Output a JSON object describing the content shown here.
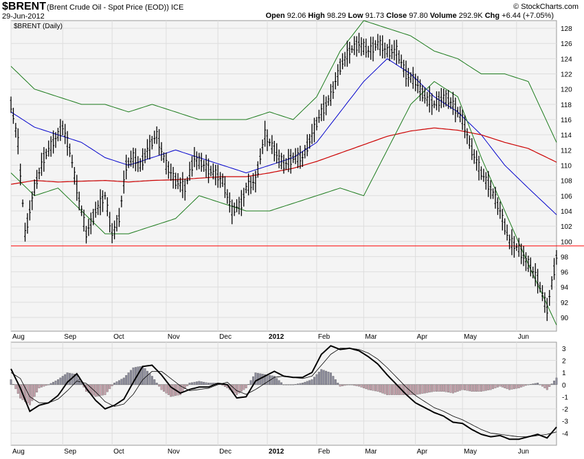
{
  "header": {
    "symbol": "$BRENT",
    "description": "(Brent Crude Oil - Spot Price (EOD))",
    "exchange": "ICE",
    "date": "29-Jun-2012",
    "brand": "© StockCharts.com",
    "open_label": "Open",
    "open": "92.06",
    "high_label": "High",
    "high": "98.29",
    "low_label": "Low",
    "low": "91.73",
    "close_label": "Close",
    "close": "97.80",
    "volume_label": "Volume",
    "volume": "292.9K",
    "chg_label": "Chg",
    "chg": "+6.44 (+7.05%)"
  },
  "colors": {
    "ma_fast": "#0000cc",
    "ma_slow": "#cc0000",
    "bollinger": "#1a7a1a",
    "support_line": "#ff0000",
    "histogram_pos": "#8a8a9a",
    "histogram_neg": "#c4a0aa"
  },
  "chart_data": [
    {
      "type": "line",
      "panel": "price",
      "legend_text": "$BRENT (Daily)",
      "x_ticks": [
        "Aug",
        "Sep",
        "Oct",
        "Nov",
        "Dec",
        "2012",
        "Feb",
        "Mar",
        "Apr",
        "May",
        "Jun"
      ],
      "x_tick_values": [
        0,
        22,
        43,
        66,
        88,
        109,
        130,
        150,
        172,
        192,
        215
      ],
      "y_ticks": [
        90,
        92,
        94,
        96,
        98,
        100,
        102,
        104,
        106,
        108,
        110,
        112,
        114,
        116,
        118,
        120,
        122,
        124,
        126,
        128
      ],
      "ylim": [
        88.2,
        129
      ],
      "xlim": [
        0,
        232
      ],
      "support_level": 99.4,
      "grid": true,
      "series": [
        {
          "style": "price-bars",
          "day": [
            0,
            3,
            6,
            10,
            14,
            18,
            22,
            25,
            28,
            32,
            36,
            40,
            43,
            46,
            49,
            52,
            55,
            58,
            62,
            66,
            70,
            74,
            78,
            82,
            86,
            90,
            94,
            98,
            100,
            104,
            108,
            112,
            116,
            120,
            124,
            128,
            132,
            136,
            140,
            144,
            148,
            152,
            156,
            160,
            164,
            168,
            172,
            176,
            180,
            184,
            188,
            192,
            196,
            200,
            204,
            208,
            212,
            216,
            220,
            224,
            228,
            232
          ],
          "close": [
            118,
            113,
            101,
            107,
            111,
            113,
            115,
            112,
            107,
            101,
            104,
            106,
            101,
            103,
            110,
            111,
            110,
            112,
            114,
            110,
            108,
            107,
            111,
            110,
            109,
            108,
            104,
            105,
            107,
            108,
            114,
            112,
            110,
            111,
            111,
            114,
            117,
            119,
            123,
            125,
            126,
            125,
            126,
            125,
            125,
            122,
            121,
            119,
            118,
            119,
            118,
            116,
            112,
            109,
            107,
            104,
            100,
            99,
            97,
            95,
            91,
            98
          ]
        },
        {
          "style": "ma-fast",
          "day": [
            0,
            10,
            20,
            30,
            40,
            50,
            60,
            70,
            80,
            90,
            100,
            110,
            120,
            130,
            140,
            150,
            160,
            170,
            180,
            190,
            200,
            210,
            220,
            232
          ],
          "value": [
            117,
            115,
            114,
            113,
            111,
            110,
            111,
            112,
            111,
            110,
            109,
            110,
            111,
            113,
            117,
            121,
            124,
            122,
            119,
            117,
            114,
            110,
            107,
            103.5
          ]
        },
        {
          "style": "ma-slow",
          "day": [
            0,
            10,
            20,
            30,
            40,
            50,
            60,
            70,
            80,
            90,
            100,
            110,
            120,
            130,
            140,
            150,
            160,
            170,
            180,
            190,
            200,
            210,
            220,
            232
          ],
          "value": [
            107.5,
            108,
            107.8,
            107.9,
            108,
            107.8,
            108,
            108.1,
            108.3,
            108.5,
            108.5,
            109,
            109.6,
            110.5,
            111.6,
            112.7,
            113.8,
            114.5,
            114.9,
            114.6,
            114,
            113,
            112.2,
            110.4
          ]
        },
        {
          "style": "bollinger-upper",
          "day": [
            0,
            10,
            20,
            30,
            40,
            50,
            60,
            70,
            80,
            90,
            100,
            110,
            120,
            130,
            140,
            150,
            160,
            170,
            180,
            190,
            200,
            210,
            220,
            232
          ],
          "value": [
            123,
            120,
            119,
            118,
            118,
            117,
            118,
            117,
            116,
            116,
            116,
            117,
            116,
            119,
            125,
            129,
            128,
            127,
            125,
            124,
            122,
            122,
            121,
            113
          ]
        },
        {
          "style": "bollinger-lower",
          "day": [
            0,
            10,
            20,
            30,
            40,
            50,
            60,
            70,
            80,
            90,
            100,
            110,
            120,
            130,
            140,
            150,
            160,
            170,
            180,
            190,
            200,
            210,
            220,
            232
          ],
          "value": [
            109,
            106,
            107,
            104,
            101,
            101,
            102,
            103,
            106,
            105,
            104,
            104,
            105,
            106,
            107,
            106,
            112,
            118,
            121,
            119,
            111,
            104,
            97,
            89
          ]
        }
      ]
    },
    {
      "type": "line",
      "panel": "indicator",
      "ylim": [
        -5,
        3.5
      ],
      "y_ticks": [
        -4,
        -3,
        -2,
        -1,
        0,
        1,
        2,
        3
      ],
      "x_ticks": [
        "Aug",
        "Sep",
        "Oct",
        "Nov",
        "Dec",
        "2012",
        "Feb",
        "Mar",
        "Apr",
        "May",
        "Jun"
      ],
      "x_tick_values": [
        0,
        22,
        43,
        66,
        88,
        109,
        130,
        150,
        172,
        192,
        215
      ],
      "series": [
        {
          "style": "indicator-main",
          "day": [
            0,
            4,
            8,
            12,
            16,
            20,
            24,
            28,
            32,
            36,
            40,
            44,
            48,
            52,
            56,
            60,
            64,
            68,
            72,
            76,
            80,
            84,
            88,
            92,
            96,
            100,
            104,
            108,
            112,
            116,
            120,
            124,
            128,
            132,
            136,
            140,
            144,
            148,
            152,
            156,
            160,
            164,
            168,
            172,
            176,
            180,
            184,
            188,
            192,
            196,
            200,
            204,
            208,
            212,
            216,
            220,
            224,
            228,
            232
          ],
          "value": [
            1.3,
            -0.3,
            -2.2,
            -1.7,
            -1.5,
            -0.9,
            0.2,
            0.9,
            -0.3,
            -1.3,
            -2.0,
            -1.7,
            -1.2,
            0.2,
            1.5,
            1.6,
            0.8,
            -0.2,
            -0.7,
            -0.4,
            -0.2,
            -0.2,
            0.1,
            0.0,
            -1.1,
            -1.0,
            0.3,
            0.7,
            1.1,
            0.7,
            0.6,
            0.6,
            1.0,
            2.5,
            3.2,
            2.9,
            3.0,
            2.8,
            2.3,
            1.7,
            0.8,
            0.0,
            -0.8,
            -1.5,
            -1.9,
            -2.3,
            -2.6,
            -3.1,
            -3.2,
            -3.7,
            -4.1,
            -4.3,
            -4.2,
            -4.5,
            -4.5,
            -4.3,
            -4.1,
            -4.4,
            -3.5
          ]
        },
        {
          "style": "indicator-signal",
          "day": [
            0,
            4,
            8,
            12,
            16,
            20,
            24,
            28,
            32,
            36,
            40,
            44,
            48,
            52,
            56,
            60,
            64,
            68,
            72,
            76,
            80,
            84,
            88,
            92,
            96,
            100,
            104,
            108,
            112,
            116,
            120,
            124,
            128,
            132,
            136,
            140,
            144,
            148,
            152,
            156,
            160,
            164,
            168,
            172,
            176,
            180,
            184,
            188,
            192,
            196,
            200,
            204,
            208,
            212,
            216,
            220,
            224,
            228,
            232
          ],
          "value": [
            1.0,
            0.5,
            -1.0,
            -1.5,
            -1.5,
            -1.2,
            -0.5,
            0.3,
            0.1,
            -0.6,
            -1.4,
            -1.8,
            -1.6,
            -0.8,
            0.4,
            1.1,
            1.1,
            0.5,
            -0.1,
            -0.5,
            -0.4,
            -0.3,
            0.0,
            0.2,
            -0.5,
            -0.8,
            -0.4,
            0.1,
            0.6,
            0.7,
            0.6,
            0.5,
            0.7,
            1.6,
            2.5,
            3.0,
            3.0,
            2.9,
            2.6,
            2.1,
            1.4,
            0.6,
            -0.2,
            -0.9,
            -1.4,
            -1.9,
            -2.2,
            -2.6,
            -2.9,
            -3.3,
            -3.7,
            -4.0,
            -4.1,
            -4.2,
            -4.3,
            -4.3,
            -4.2,
            -4.1,
            -3.9
          ]
        }
      ]
    }
  ]
}
